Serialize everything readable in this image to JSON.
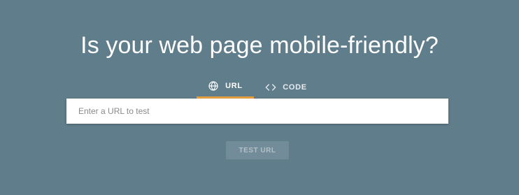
{
  "page": {
    "title": "Is your web page mobile-friendly?"
  },
  "tabs": {
    "url_label": "URL",
    "url_icon": "globe-icon",
    "code_label": "CODE",
    "code_icon": "code-brackets-icon",
    "selected": "URL"
  },
  "url_input": {
    "value": "",
    "placeholder": "Enter a URL to test"
  },
  "actions": {
    "test_button_label": "TEST URL"
  },
  "colors": {
    "background": "#607d8b",
    "selected_tab_indicator": "#e8a13f",
    "input_background": "#ffffff"
  }
}
